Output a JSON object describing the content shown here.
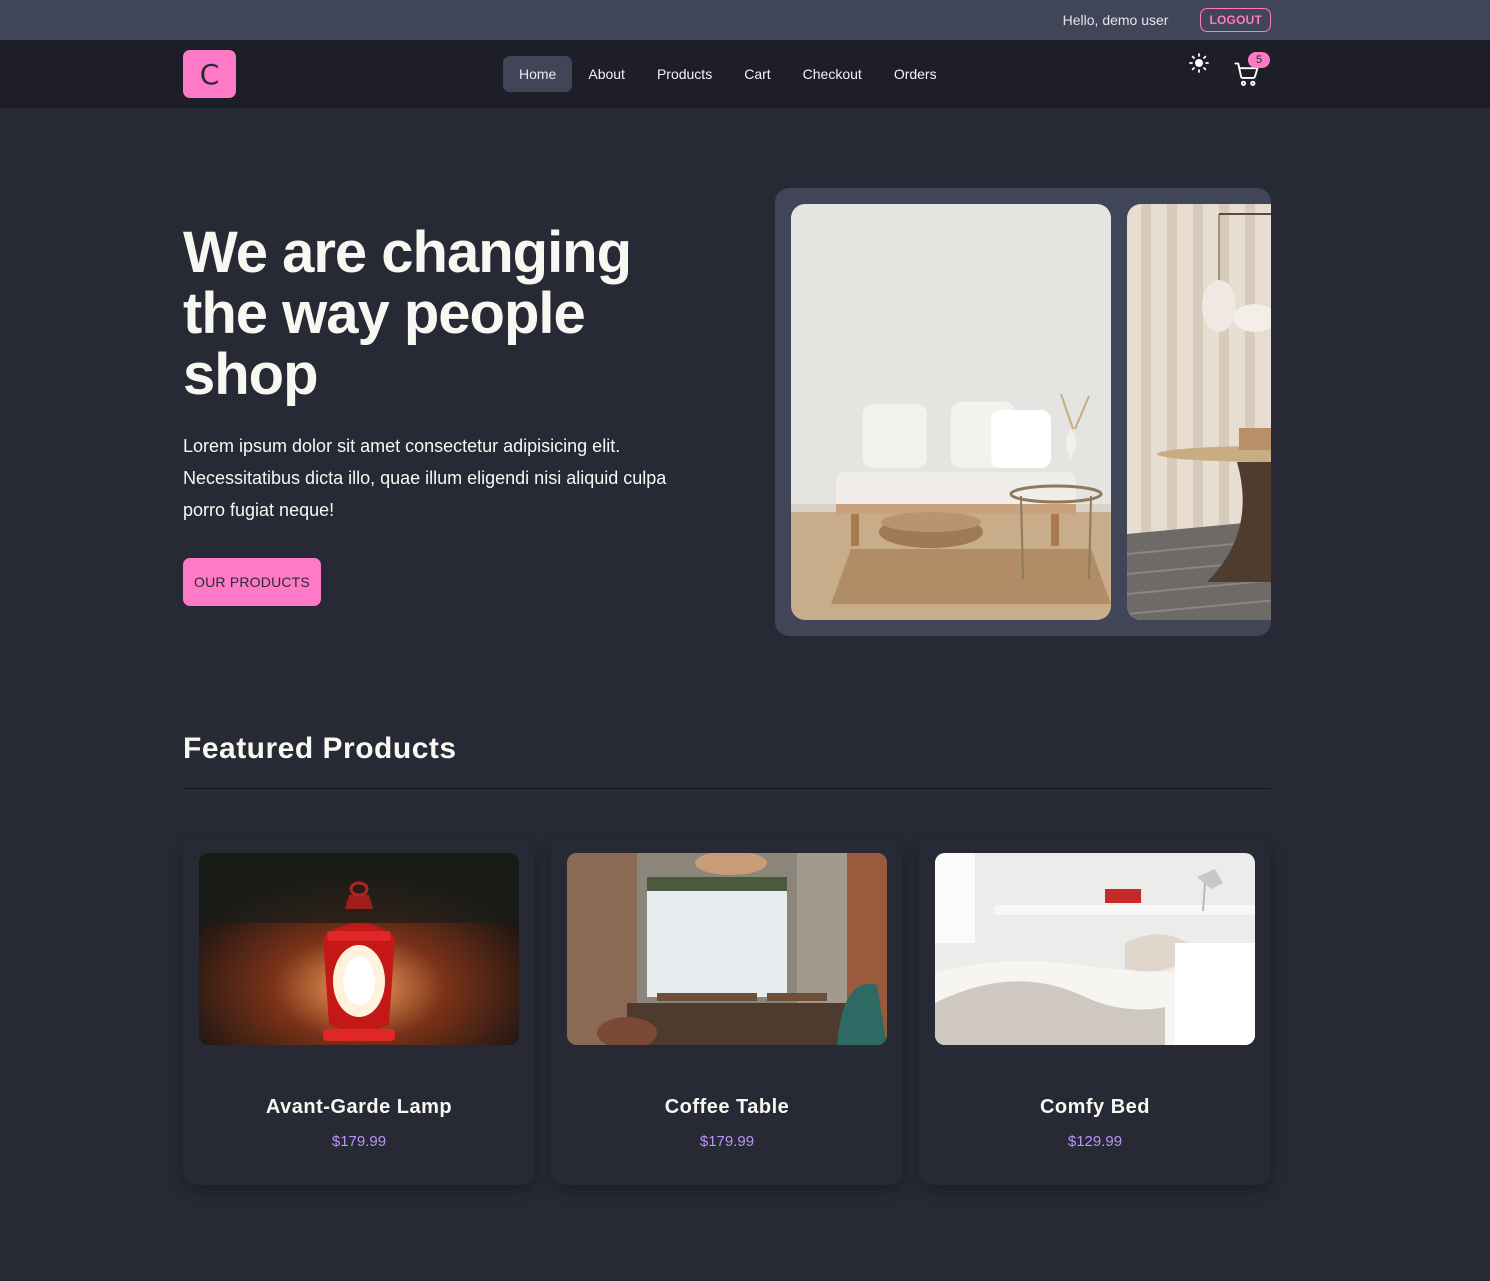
{
  "topbar": {
    "greeting": "Hello, demo user",
    "logout_label": "LOGOUT"
  },
  "navbar": {
    "logo_letter": "C",
    "links": [
      {
        "label": "Home",
        "active": true
      },
      {
        "label": "About"
      },
      {
        "label": "Products"
      },
      {
        "label": "Cart"
      },
      {
        "label": "Checkout"
      },
      {
        "label": "Orders"
      }
    ],
    "theme_icon": "sun-icon",
    "cart_icon": "cart-icon",
    "cart_count": "5"
  },
  "hero": {
    "title": "We are changing the way people shop",
    "text": "Lorem ipsum dolor sit amet consectetur adipisicing elit. Necessitatibus dicta illo, quae illum eligendi nisi aliquid culpa porro fugiat neque!",
    "button_label": "OUR PRODUCTS"
  },
  "featured": {
    "title": "Featured Products",
    "products": [
      {
        "name": "Avant-Garde Lamp",
        "price": "$179.99"
      },
      {
        "name": "Coffee Table",
        "price": "$179.99"
      },
      {
        "name": "Comfy Bed",
        "price": "$129.99"
      }
    ]
  },
  "colors": {
    "accent": "#ff7ac6",
    "price": "#bd93f9",
    "background": "#272935",
    "navbar": "#1d1e28",
    "topbar": "#414558"
  }
}
